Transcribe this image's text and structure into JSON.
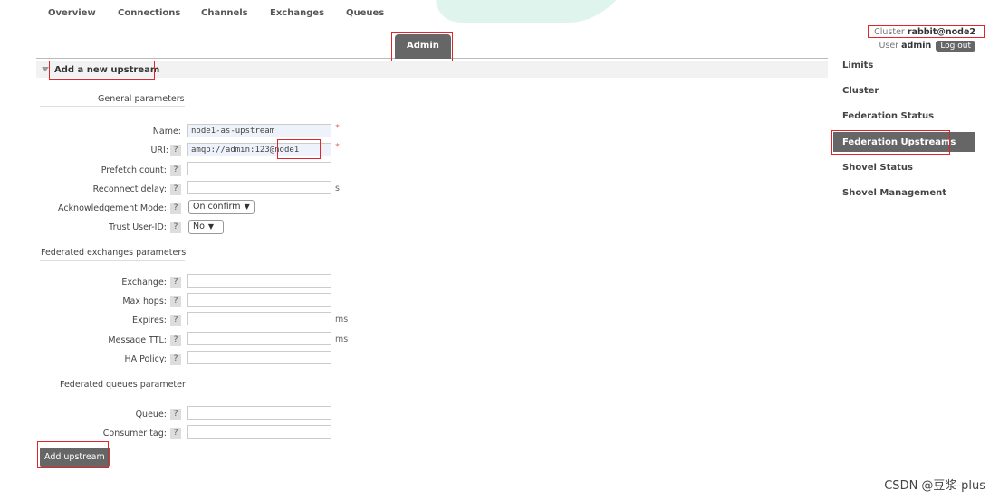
{
  "tabs": [
    {
      "label": "Overview"
    },
    {
      "label": "Connections"
    },
    {
      "label": "Channels"
    },
    {
      "label": "Exchanges"
    },
    {
      "label": "Queues"
    },
    {
      "label": "Admin",
      "active": true
    }
  ],
  "cluster": {
    "prefix": "Cluster",
    "name": "rabbit@node2"
  },
  "user": {
    "prefix": "User",
    "name": "admin",
    "logout_label": "Log out"
  },
  "section": {
    "title": "Add a new upstream"
  },
  "general": {
    "heading": "General parameters",
    "name_label": "Name:",
    "name_value": "node1-as-upstream",
    "uri_label": "URI:",
    "uri_value": "amqp://admin:123@node1",
    "prefetch_label": "Prefetch count:",
    "reconnect_label": "Reconnect delay:",
    "reconnect_unit": "s",
    "ack_label": "Acknowledgement Mode:",
    "ack_value": "On confirm",
    "trust_label": "Trust User-ID:",
    "trust_value": "No",
    "required_mark": "*",
    "help": "?"
  },
  "exchanges": {
    "heading": "Federated exchanges parameters",
    "exchange_label": "Exchange:",
    "maxhops_label": "Max hops:",
    "expires_label": "Expires:",
    "expires_unit": "ms",
    "ttl_label": "Message TTL:",
    "ttl_unit": "ms",
    "ha_label": "HA Policy:"
  },
  "queues": {
    "heading": "Federated queues parameter",
    "queue_label": "Queue:",
    "consumer_label": "Consumer tag:"
  },
  "add_button": "Add upstream",
  "sidebar": [
    {
      "label": "Limits"
    },
    {
      "label": "Cluster"
    },
    {
      "label": "Federation Status"
    },
    {
      "label": "Federation Upstreams",
      "active": true
    },
    {
      "label": "Shovel Status"
    },
    {
      "label": "Shovel Management"
    }
  ],
  "watermark": "CSDN @豆浆-plus",
  "colors": {
    "highlight": "#e0252b",
    "active_bg": "#666666"
  }
}
